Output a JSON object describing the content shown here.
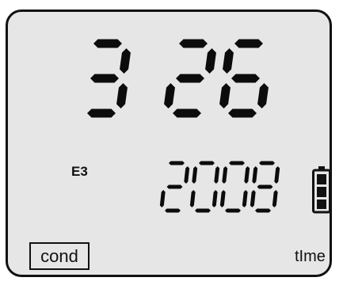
{
  "display": {
    "main_value": "3 26",
    "year": "2008",
    "mode_code": "E3",
    "cond_label": "cond",
    "time_label": "tIme",
    "battery_level": 1.0
  },
  "icons": {
    "battery": "battery-full-icon"
  },
  "colors": {
    "lcd_background": "#e6e6e6",
    "segment": "#0c0c0c",
    "frame": "#111111"
  }
}
